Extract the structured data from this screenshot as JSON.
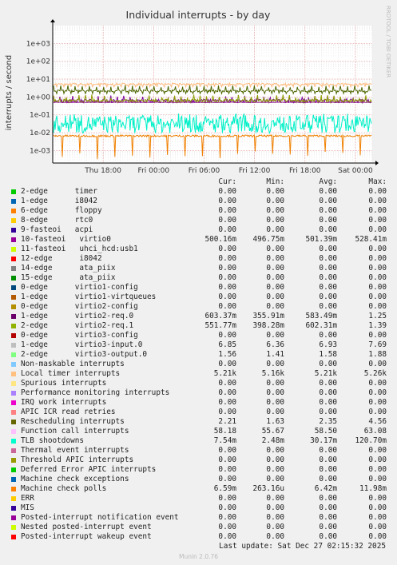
{
  "chart_data": {
    "type": "line",
    "title": "Individual interrupts - by day",
    "ylabel": "interrupts / second",
    "watermark": "RRDTOOL / TOBI OETIKER",
    "yscale": "log",
    "ylim": [
      0.0002,
      10000
    ],
    "yticks": [
      "1e+03",
      "1e+02",
      "1e+01",
      "1e+00",
      "1e-01",
      "1e-02",
      "1e-03"
    ],
    "yticks_values": [
      1000,
      100,
      10,
      1,
      0.1,
      0.01,
      0.001
    ],
    "xlim_hours": [
      -6,
      32
    ],
    "xticks": [
      "Thu 18:00",
      "Fri 00:00",
      "Fri 06:00",
      "Fri 12:00",
      "Fri 18:00",
      "Sat 00:00"
    ],
    "xticks_hours": [
      0,
      6,
      12,
      18,
      24,
      30
    ],
    "grid": true,
    "series": [
      {
        "name": "Local timer interrupts",
        "color": "#ffbc80",
        "typical": 5.21,
        "min": 1.8,
        "max": 5.3
      },
      {
        "name": "Rescheduling interrupts",
        "color": "#4d6600",
        "typical": 2.2,
        "min": 1.5,
        "max": 4.6
      },
      {
        "name": "virtio2-req.0",
        "color": "#7a00a0",
        "typical": 0.6,
        "min": 0.36,
        "max": 1.25
      },
      {
        "name": "virtio2-req.1",
        "color": "#8fa000",
        "typical": 0.6,
        "min": 0.4,
        "max": 1.39
      },
      {
        "name": "virtio0",
        "color": "#8a0b8a",
        "typical": 0.5,
        "min": 0.49,
        "max": 0.53
      },
      {
        "name": "TLB shootdowns",
        "color": "#00f0c8",
        "typical": 0.03,
        "min": 0.0025,
        "max": 0.12
      },
      {
        "name": "Machine check polls",
        "color": "#f08000",
        "typical": 0.0066,
        "min": 0.0003,
        "max": 0.012
      }
    ]
  },
  "legend": {
    "headers": [
      "Cur:",
      "Min:",
      "Avg:",
      "Max:"
    ],
    "rows": [
      {
        "label": "2-edge      timer",
        "color": "#00cc00",
        "cur": "0.00",
        "min": "0.00",
        "avg": "0.00",
        "max": "0.00"
      },
      {
        "label": "1-edge      i8042",
        "color": "#0066b3",
        "cur": "0.00",
        "min": "0.00",
        "avg": "0.00",
        "max": "0.00"
      },
      {
        "label": "6-edge      floppy",
        "color": "#ff8000",
        "cur": "0.00",
        "min": "0.00",
        "avg": "0.00",
        "max": "0.00"
      },
      {
        "label": "8-edge      rtc0",
        "color": "#ffcc00",
        "cur": "0.00",
        "min": "0.00",
        "avg": "0.00",
        "max": "0.00"
      },
      {
        "label": "9-fasteoi   acpi",
        "color": "#330099",
        "cur": "0.00",
        "min": "0.00",
        "avg": "0.00",
        "max": "0.00"
      },
      {
        "label": "10-fasteoi   virtio0",
        "color": "#990099",
        "cur": "500.16m",
        "min": "496.75m",
        "avg": "501.39m",
        "max": "528.41m"
      },
      {
        "label": "11-fasteoi   uhci_hcd:usb1",
        "color": "#ccff00",
        "cur": "0.00",
        "min": "0.00",
        "avg": "0.00",
        "max": "0.00"
      },
      {
        "label": "12-edge      i8042",
        "color": "#ff0000",
        "cur": "0.00",
        "min": "0.00",
        "avg": "0.00",
        "max": "0.00"
      },
      {
        "label": "14-edge      ata_piix",
        "color": "#808080",
        "cur": "0.00",
        "min": "0.00",
        "avg": "0.00",
        "max": "0.00"
      },
      {
        "label": "15-edge      ata_piix",
        "color": "#008f00",
        "cur": "0.00",
        "min": "0.00",
        "avg": "0.00",
        "max": "0.00"
      },
      {
        "label": "0-edge      virtio1-config",
        "color": "#00487d",
        "cur": "0.00",
        "min": "0.00",
        "avg": "0.00",
        "max": "0.00"
      },
      {
        "label": "1-edge      virtio1-virtqueues",
        "color": "#b35a00",
        "cur": "0.00",
        "min": "0.00",
        "avg": "0.00",
        "max": "0.00"
      },
      {
        "label": "0-edge      virtio2-config",
        "color": "#b38f00",
        "cur": "0.00",
        "min": "0.00",
        "avg": "0.00",
        "max": "0.00"
      },
      {
        "label": "1-edge      virtio2-req.0",
        "color": "#6b006b",
        "cur": "603.37m",
        "min": "355.91m",
        "avg": "583.49m",
        "max": "1.25"
      },
      {
        "label": "2-edge      virtio2-req.1",
        "color": "#8fb300",
        "cur": "551.77m",
        "min": "398.28m",
        "avg": "602.31m",
        "max": "1.39"
      },
      {
        "label": "0-edge      virtio3-config",
        "color": "#b30000",
        "cur": "0.00",
        "min": "0.00",
        "avg": "0.00",
        "max": "0.00"
      },
      {
        "label": "1-edge      virtio3-input.0",
        "color": "#bebebe",
        "cur": "6.85",
        "min": "6.36",
        "avg": "6.93",
        "max": "7.69"
      },
      {
        "label": "2-edge      virtio3-output.0",
        "color": "#80ff80",
        "cur": "1.56",
        "min": "1.41",
        "avg": "1.58",
        "max": "1.88"
      },
      {
        "label": "Non-maskable interrupts",
        "color": "#80c9ff",
        "cur": "0.00",
        "min": "0.00",
        "avg": "0.00",
        "max": "0.00"
      },
      {
        "label": "Local timer interrupts",
        "color": "#ffc080",
        "cur": "5.21k",
        "min": "5.16k",
        "avg": "5.21k",
        "max": "5.26k"
      },
      {
        "label": "Spurious interrupts",
        "color": "#ffe680",
        "cur": "0.00",
        "min": "0.00",
        "avg": "0.00",
        "max": "0.00"
      },
      {
        "label": "Performance monitoring interrupts",
        "color": "#aa80ff",
        "cur": "0.00",
        "min": "0.00",
        "avg": "0.00",
        "max": "0.00"
      },
      {
        "label": "IRQ work interrupts",
        "color": "#ee00cc",
        "cur": "0.00",
        "min": "0.00",
        "avg": "0.00",
        "max": "0.00"
      },
      {
        "label": "APIC ICR read retries",
        "color": "#ff8080",
        "cur": "0.00",
        "min": "0.00",
        "avg": "0.00",
        "max": "0.00"
      },
      {
        "label": "Rescheduling interrupts",
        "color": "#666600",
        "cur": "2.21",
        "min": "1.63",
        "avg": "2.35",
        "max": "4.56"
      },
      {
        "label": "Function call interrupts",
        "color": "#ffbfff",
        "cur": "58.18",
        "min": "55.67",
        "avg": "58.50",
        "max": "63.08"
      },
      {
        "label": "TLB shootdowns",
        "color": "#00ffcc",
        "cur": "7.54m",
        "min": "2.48m",
        "avg": "30.17m",
        "max": "120.70m"
      },
      {
        "label": "Thermal event interrupts",
        "color": "#cc6699",
        "cur": "0.00",
        "min": "0.00",
        "avg": "0.00",
        "max": "0.00"
      },
      {
        "label": "Threshold APIC interrupts",
        "color": "#999900",
        "cur": "0.00",
        "min": "0.00",
        "avg": "0.00",
        "max": "0.00"
      },
      {
        "label": "Deferred Error APIC interrupts",
        "color": "#00cc00",
        "cur": "0.00",
        "min": "0.00",
        "avg": "0.00",
        "max": "0.00"
      },
      {
        "label": "Machine check exceptions",
        "color": "#0066b3",
        "cur": "0.00",
        "min": "0.00",
        "avg": "0.00",
        "max": "0.00"
      },
      {
        "label": "Machine check polls",
        "color": "#ff8000",
        "cur": "6.59m",
        "min": "263.16u",
        "avg": "6.42m",
        "max": "11.98m"
      },
      {
        "label": "ERR",
        "color": "#ffcc00",
        "cur": "0.00",
        "min": "0.00",
        "avg": "0.00",
        "max": "0.00"
      },
      {
        "label": "MIS",
        "color": "#330099",
        "cur": "0.00",
        "min": "0.00",
        "avg": "0.00",
        "max": "0.00"
      },
      {
        "label": "Posted-interrupt notification event",
        "color": "#990099",
        "cur": "0.00",
        "min": "0.00",
        "avg": "0.00",
        "max": "0.00"
      },
      {
        "label": "Nested posted-interrupt event",
        "color": "#ccff00",
        "cur": "0.00",
        "min": "0.00",
        "avg": "0.00",
        "max": "0.00"
      },
      {
        "label": "Posted-interrupt wakeup event",
        "color": "#ff0000",
        "cur": "0.00",
        "min": "0.00",
        "avg": "0.00",
        "max": "0.00"
      }
    ]
  },
  "footer": {
    "last_update": "Last update: Sat Dec 27 02:15:32 2025",
    "version": "Munin 2.0.76"
  }
}
